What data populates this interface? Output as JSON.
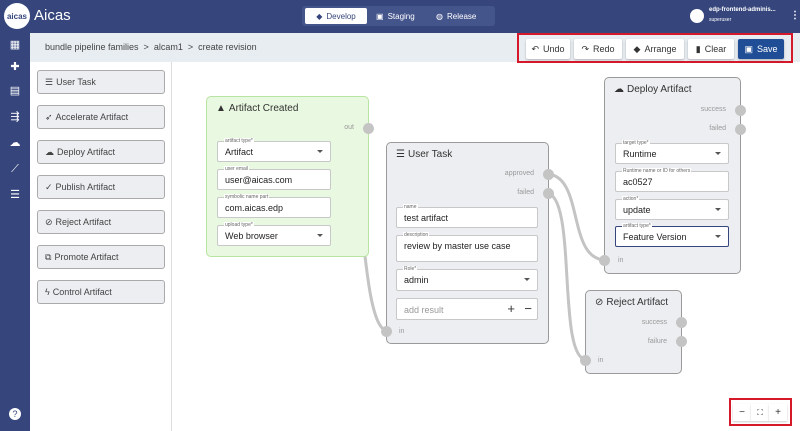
{
  "app": {
    "title": "Aicas",
    "logo_text": "aicas"
  },
  "env_tabs": [
    {
      "label": "Develop",
      "icon": "layers-icon",
      "active": true
    },
    {
      "label": "Staging",
      "icon": "clipboard-icon",
      "active": false
    },
    {
      "label": "Release",
      "icon": "globe-icon",
      "active": false
    }
  ],
  "user": {
    "name": "edp-frontend-adminis...",
    "role": "superuser"
  },
  "leftnav": [
    "dashboard-icon",
    "puzzle-icon",
    "grid-icon",
    "flow-icon",
    "cloud-upload-icon",
    "trend-icon",
    "checklist-icon",
    "help-icon"
  ],
  "breadcrumb": "bundle pipeline families  >  alcam1  >  create revision",
  "toolbar": {
    "undo": "Undo",
    "redo": "Redo",
    "arrange": "Arrange",
    "clear": "Clear",
    "save": "Save"
  },
  "palette": [
    "User Task",
    "Accelerate Artifact",
    "Deploy Artifact",
    "Publish Artifact",
    "Reject Artifact",
    "Promote Artifact",
    "Control Artifact"
  ],
  "nodes": {
    "artifact_created": {
      "title": "Artifact Created",
      "out": "out",
      "fields": [
        {
          "label": "artifact type*",
          "value": "Artifact"
        },
        {
          "label": "user email",
          "value": "user@aicas.com"
        },
        {
          "label": "symbolic name part",
          "value": "com.aicas.edp"
        },
        {
          "label": "upload type*",
          "value": "Web browser"
        }
      ]
    },
    "user_task": {
      "title": "User Task",
      "approved": "approved",
      "failed": "failed",
      "in": "in",
      "fields": [
        {
          "label": "name",
          "value": "test artifact"
        },
        {
          "label": "description",
          "value": "review by master use case"
        },
        {
          "label": "Role*",
          "value": "admin"
        }
      ],
      "add_result_placeholder": "add result"
    },
    "deploy_artifact": {
      "title": "Deploy Artifact",
      "success": "success",
      "failed": "failed",
      "in": "in",
      "fields": [
        {
          "label": "target type*",
          "value": "Runtime"
        },
        {
          "label": "Runtime name or ID for others",
          "value": "ac0527"
        },
        {
          "label": "action*",
          "value": "update"
        },
        {
          "label": "artifact type*",
          "value": "Feature Version"
        }
      ]
    },
    "reject_artifact": {
      "title": "Reject Artifact",
      "success": "success",
      "failure": "failure",
      "in": "in"
    }
  },
  "zoom_controls": {
    "out": "−",
    "fit": "⛶",
    "in": "+"
  },
  "colors": {
    "nav": "#36467d",
    "save": "#1f4e96",
    "highlight": "#d5192b",
    "start_node": "#e9f8e0"
  }
}
